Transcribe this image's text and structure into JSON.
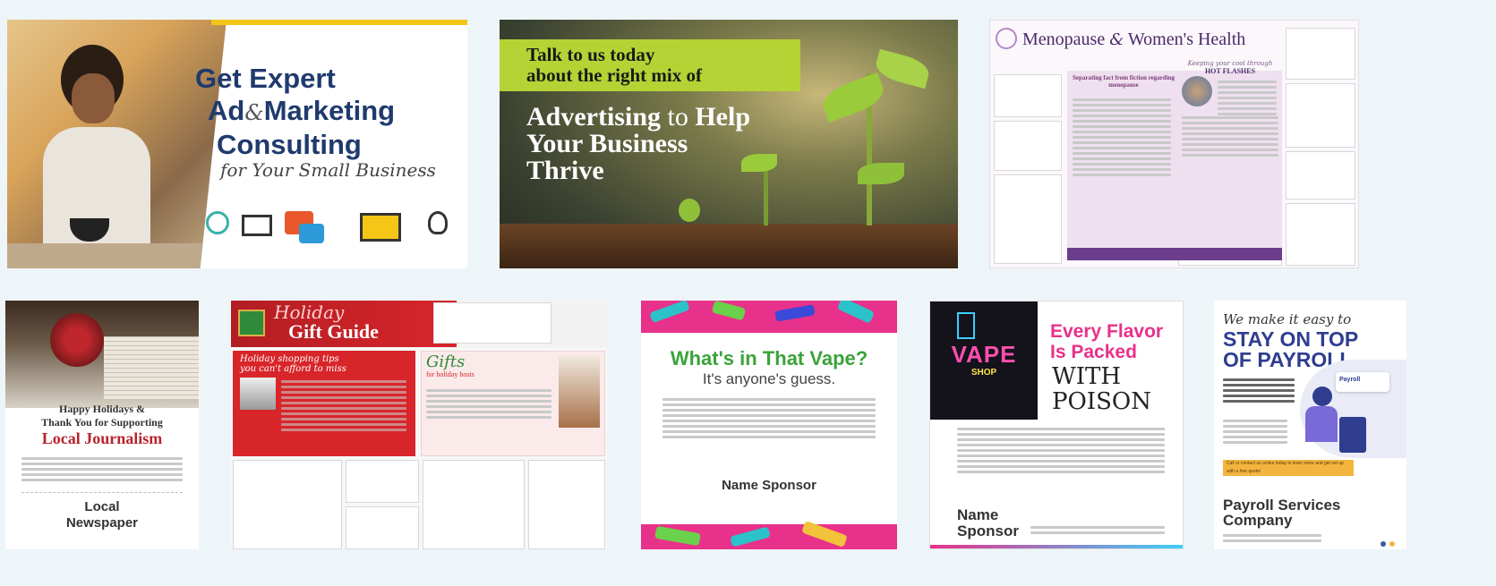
{
  "tiles": {
    "consulting": {
      "line1": "Get Expert",
      "line2a": "Ad",
      "amp": "&",
      "line2b": "Marketing",
      "line3": "Consulting",
      "script": "for Your Small Business",
      "accent": "#f5c518",
      "navy": "#1f3a6d"
    },
    "advertising": {
      "banner_line1": "Talk to us today",
      "banner_line2": "about the right mix of",
      "headline1a": "Advertising",
      "headline1b": "to",
      "headline1c": "Help",
      "headline2": "Your Business",
      "headline3": "Thrive",
      "banner_color": "#b5d334"
    },
    "menopause": {
      "title_a": "Menopause",
      "title_amp": "&",
      "title_b": "Women's Health",
      "sub_heading": "Separating fact from fiction regarding menopause",
      "side_heading_a": "Keeping your cool through",
      "side_heading_b": "HOT FLASHES",
      "accent": "#6b3d8c"
    },
    "journalism": {
      "line1": "Happy Holidays &",
      "line2": "Thank You for Supporting",
      "line3": "Local Journalism",
      "sponsor1": "Local",
      "sponsor2": "Newspaper",
      "accent": "#b8232b"
    },
    "gift": {
      "title1": "Holiday",
      "title2": "Gift Guide",
      "left_heading_a": "Holiday shopping tips",
      "left_heading_b": "you can't afford to miss",
      "right_heading_a": "Gifts",
      "right_heading_b": "for holiday hosts",
      "red": "#d8252a"
    },
    "vape": {
      "headline": "What's in That Vape?",
      "sub": "It's anyone's guess.",
      "sponsor": "Name Sponsor",
      "green": "#3aa33b",
      "pink": "#e8318a"
    },
    "flavor": {
      "neon1": "VAPE",
      "neon2": "SHOP",
      "headline1": "Every Flavor",
      "headline2": "Is Packed",
      "hand1": "WITH",
      "hand2": "POISON",
      "sponsor1": "Name",
      "sponsor2": "Sponsor",
      "pink": "#e8318a"
    },
    "payroll": {
      "script": "We make it easy to",
      "line1": "STAY ON TOP",
      "line2": "OF PAYROLL",
      "cta": "Call or contact us online today to learn more and get set up with a free quote!",
      "company1": "Payroll Services",
      "company2": "Company",
      "widget": "Payroll",
      "navy": "#2f3d8f",
      "accent": "#f4b53f"
    }
  }
}
